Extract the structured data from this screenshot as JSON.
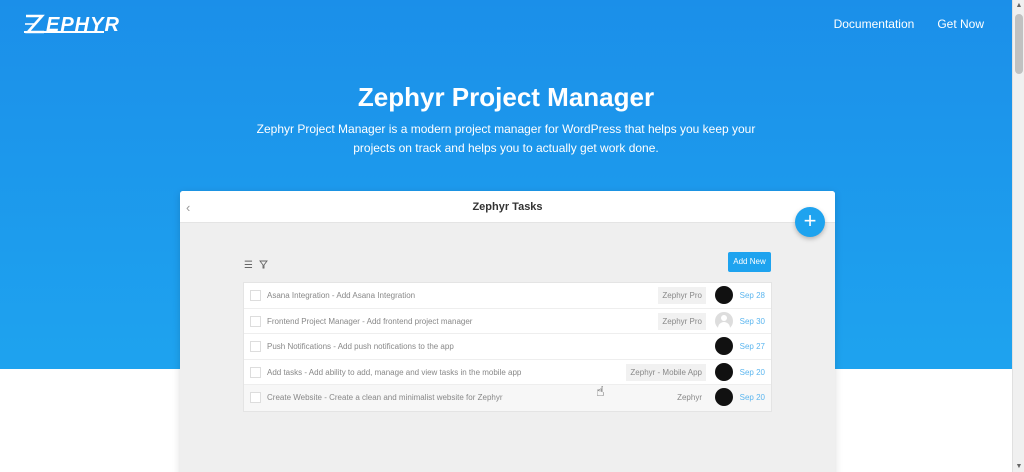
{
  "brand": {
    "logo_text": "ZEPHYR",
    "logo_rest": "EPHYR"
  },
  "nav": {
    "documentation": "Documentation",
    "get_now": "Get Now"
  },
  "hero": {
    "title": "Zephyr Project Manager",
    "subtitle": "Zephyr Project Manager is a modern project manager for WordPress that helps you keep your projects on track and helps you to actually get work done."
  },
  "app": {
    "title": "Zephyr Tasks",
    "back_icon": "chevron-left-icon",
    "add_new_label": "Add New",
    "fab_label": "+",
    "tasks": [
      {
        "text": "Asana Integration - Add Asana Integration",
        "project": "Zephyr Pro",
        "date": "Sep 28",
        "avatar": "dark"
      },
      {
        "text": "Frontend Project Manager - Add frontend project manager",
        "project": "Zephyr Pro",
        "date": "Sep 30",
        "avatar": "light"
      },
      {
        "text": "Push Notifications - Add push notifications to the app",
        "project": "",
        "date": "Sep 27",
        "avatar": "dark"
      },
      {
        "text": "Add tasks - Add ability to add, manage and view tasks in the mobile app",
        "project": "Zephyr - Mobile App",
        "date": "Sep 20",
        "avatar": "dark"
      },
      {
        "text": "Create Website - Create a clean and minimalist website for Zephyr",
        "project": "Zephyr",
        "date": "Sep 20",
        "avatar": "dark"
      }
    ]
  },
  "colors": {
    "accent": "#1ea3ef",
    "date": "#5cb6ef"
  }
}
